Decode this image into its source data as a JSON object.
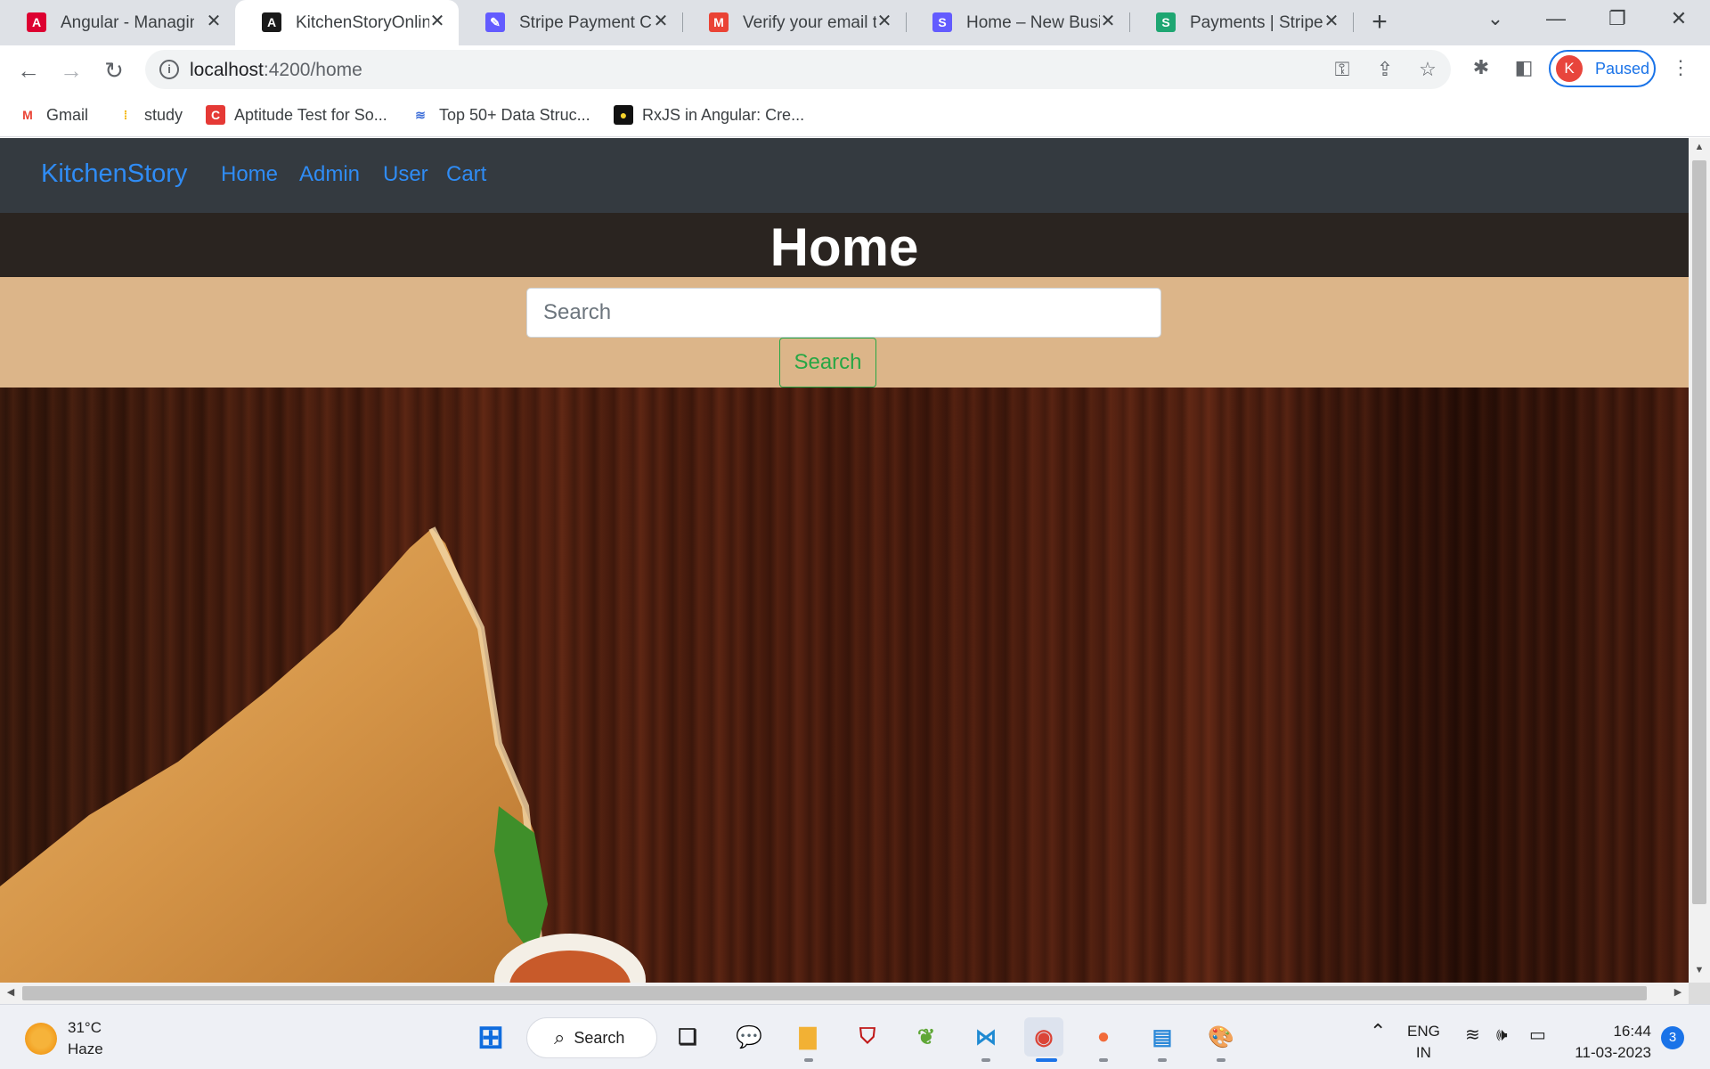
{
  "browser": {
    "tabs": [
      {
        "title": "Angular - Managing",
        "icon": "angular-red-icon",
        "color": "#dd0031",
        "glyph": "A"
      },
      {
        "title": "KitchenStoryOnline",
        "icon": "angular-black-icon",
        "color": "#1a1a1a",
        "glyph": "A"
      },
      {
        "title": "Stripe Payment Che",
        "icon": "stripe-tool-icon",
        "color": "#635bff",
        "glyph": "✎"
      },
      {
        "title": "Verify your email to",
        "icon": "gmail-icon",
        "color": "#ea4335",
        "glyph": "M"
      },
      {
        "title": "Home – New Busine",
        "icon": "stripe-s-icon",
        "color": "#635bff",
        "glyph": "S"
      },
      {
        "title": "Payments | Stripe D",
        "icon": "stripe-green-s-icon",
        "color": "#1ea672",
        "glyph": "S"
      }
    ],
    "new_tab": "+",
    "url_host": "localhost",
    "url_path": ":4200/home",
    "profile_initial": "K",
    "profile_status": "Paused",
    "bookmarks": [
      {
        "label": "Gmail",
        "icon": "gmail-icon",
        "color": "#ea4335",
        "glyph": "M"
      },
      {
        "label": "study",
        "icon": "chart-bars-icon",
        "color": "#f4b400",
        "glyph": "⁞"
      },
      {
        "label": "Aptitude Test for So...",
        "icon": "c-logo-icon",
        "color": "#e53935",
        "glyph": "C"
      },
      {
        "label": "Top 50+ Data Struc...",
        "icon": "data-struct-icon",
        "color": "#3f6fd8",
        "glyph": "≋"
      },
      {
        "label": "RxJS in Angular: Cre...",
        "icon": "bulb-icon",
        "color": "#111111",
        "glyph": "●"
      }
    ]
  },
  "app": {
    "brand": "KitchenStory",
    "nav": [
      "Home",
      "Admin",
      "User",
      "Cart"
    ],
    "heading": "Home",
    "search_placeholder": "Search",
    "search_button": "Search"
  },
  "taskbar": {
    "temperature": "31°C",
    "weather": "Haze",
    "search_label": "Search",
    "lang_top": "ENG",
    "lang_bottom": "IN",
    "time": "16:44",
    "date": "11-03-2023",
    "notifications": "3"
  },
  "colors": {
    "nav_bg": "#343a40",
    "link": "#2f8cf5",
    "search_band": "#dcb589",
    "search_button": "#28a745"
  }
}
